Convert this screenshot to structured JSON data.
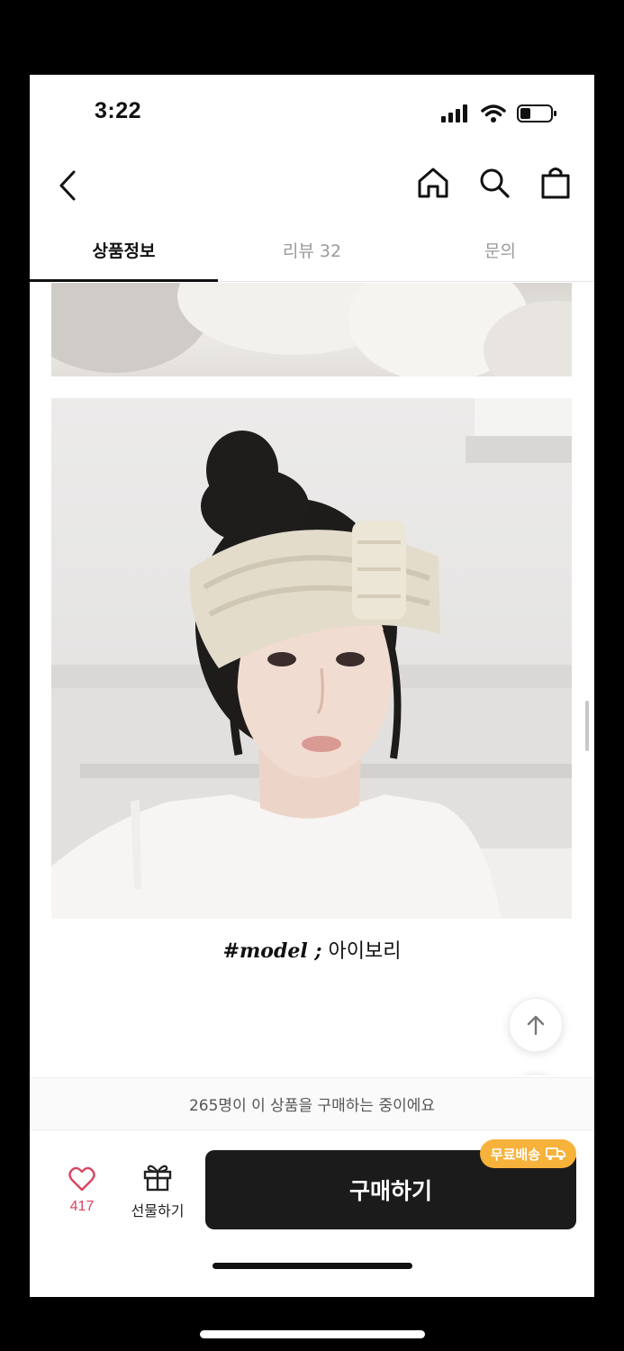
{
  "status_bar": {
    "time": "3:22"
  },
  "nav": {
    "back_icon": "chevron-left-icon",
    "actions": [
      "home-icon",
      "search-icon",
      "shopping-bag-icon"
    ]
  },
  "tabs": [
    {
      "label": "상품정보",
      "active": true
    },
    {
      "label": "리뷰 32",
      "active": false
    },
    {
      "label": "문의",
      "active": false
    }
  ],
  "content": {
    "caption_tag": "#model ;",
    "caption_color": "아이보리"
  },
  "notice": {
    "text": "265명이 이 상품을 구매하는 중이에요"
  },
  "bottom_bar": {
    "wish_count": "417",
    "gift_label": "선물하기",
    "buy_label": "구매하기",
    "free_shipping_label": "무료배송"
  },
  "colors": {
    "accent_red": "#d9445e",
    "badge_orange": "#f7b23b",
    "buy_dark": "#1b1b1b"
  }
}
